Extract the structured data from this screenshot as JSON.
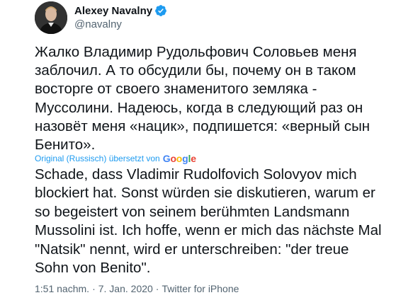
{
  "tweet": {
    "author": {
      "display_name": "Alexey Navalny",
      "handle": "@navalny",
      "verified_icon": "verified-badge-icon",
      "avatar_icon": "avatar"
    },
    "text_original": "Жалко Владимир Рудольфович Соловьев меня\nзаблочил. А то обсудили бы, почему он в таком\nвосторге от своего знаменитого земляка -\nМуссолини. Надеюсь, когда в следующий раз он\nназовёт меня «нацик», подпишется: «верный сын\nБенито».",
    "translation": {
      "note": "Original (Russisch) übersetzt von",
      "provider": "Google",
      "text": "Schade, dass Vladimir Rudolfovich Solovyov mich\nblockiert hat. Sonst würden sie diskutieren, warum er\nso begeistert von seinem berühmten Landsmann\nMussolini ist. Ich hoffe, wenn er mich das nächste Mal\n\"Natsik\" nennt, wird er unterschreiben: \"der treue\nSohn von Benito\"."
    },
    "meta": {
      "time": "1:51 nachm.",
      "separator1": "·",
      "date": "7. Jan. 2020",
      "separator2": "·",
      "source": "Twitter for iPhone"
    }
  },
  "colors": {
    "text": "#0f1419",
    "secondary": "#536471",
    "link": "#1d9bf0",
    "verified": "#1d9bf0",
    "google_blue": "#4285f4",
    "google_red": "#ea4335",
    "google_yellow": "#fbbc05",
    "google_green": "#34a853"
  }
}
